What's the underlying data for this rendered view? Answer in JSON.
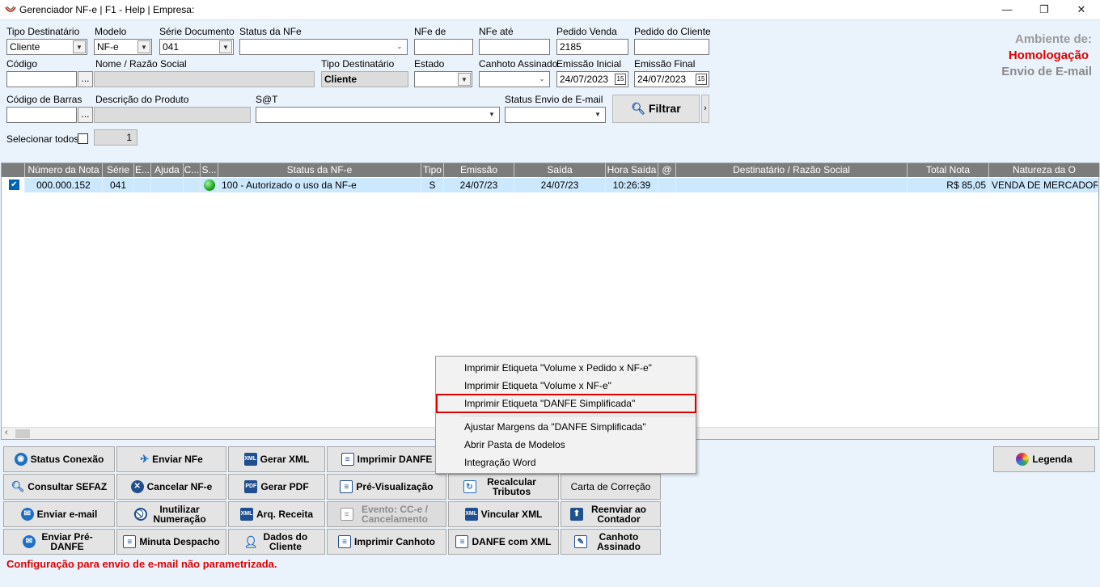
{
  "window": {
    "title": "Gerenciador NF-e | F1 - Help | Empresa:",
    "minimize": "—",
    "maximize": "❐",
    "close": "✕"
  },
  "filters": {
    "tipo_destinatario": {
      "label": "Tipo Destinatário",
      "value": "Cliente"
    },
    "modelo": {
      "label": "Modelo",
      "value": "NF-e"
    },
    "serie_documento": {
      "label": "Série Documento",
      "value": "041"
    },
    "status_nfe": {
      "label": "Status da NFe",
      "value": ""
    },
    "nfe_de": {
      "label": "NFe de",
      "value": ""
    },
    "nfe_ate": {
      "label": "NFe até",
      "value": ""
    },
    "pedido_venda": {
      "label": "Pedido Venda",
      "value": "2185"
    },
    "pedido_cliente": {
      "label": "Pedido do Cliente",
      "value": ""
    },
    "codigo": {
      "label": "Código",
      "value": "",
      "button": "..."
    },
    "nome_razao": {
      "label": "Nome / Razão Social",
      "value": ""
    },
    "tipo_destinatario2": {
      "label": "Tipo Destinatário",
      "value": "Cliente"
    },
    "estado": {
      "label": "Estado",
      "value": ""
    },
    "canhoto_assinado": {
      "label": "Canhoto Assinado",
      "value": ""
    },
    "emissao_inicial": {
      "label": "Emissão Inicial",
      "value": "24/07/2023"
    },
    "emissao_final": {
      "label": "Emissão Final",
      "value": "24/07/2023"
    },
    "codigo_barras": {
      "label": "Código de Barras",
      "value": "",
      "button": "..."
    },
    "descricao_produto": {
      "label": "Descrição do Produto",
      "value": ""
    },
    "sat": {
      "label": "S@T",
      "value": ""
    },
    "status_envio_email": {
      "label": "Status Envio de E-mail",
      "value": ""
    },
    "filtrar": "Filtrar",
    "filtrar_more": "›",
    "selecionar_todos": "Selecionar todos?",
    "count": "1"
  },
  "environment": {
    "line1": "Ambiente de:",
    "line2": "Homologação",
    "line3": "Envio de E-mail"
  },
  "grid": {
    "headers": [
      "",
      "Número da Nota",
      "Série",
      "E...",
      "Ajuda",
      "C...",
      "S...",
      "Status da NF-e",
      "Tipo",
      "Emissão",
      "Saída",
      "Hora Saída",
      "@",
      "Destinatário / Razão Social",
      "Total Nota",
      "Natureza da O"
    ],
    "rows": [
      {
        "checked": true,
        "numero": "000.000.152",
        "serie": "041",
        "e": "",
        "ajuda": "",
        "c": "",
        "status": "100 - Autorizado o uso da NF-e",
        "tipo": "S",
        "emissao": "24/07/23",
        "saida": "24/07/23",
        "hora": "10:26:39",
        "at": "",
        "destinatario": "",
        "total": "R$ 85,05",
        "natureza": "VENDA DE MERCADORIA"
      }
    ]
  },
  "context_menu": {
    "items": [
      "Imprimir Etiqueta \"Volume x Pedido x NF-e\"",
      "Imprimir Etiqueta \"Volume x NF-e\"",
      "Imprimir Etiqueta \"DANFE Simplificada\"",
      "Ajustar Margens da \"DANFE Simplificada\"",
      "Abrir Pasta de Modelos",
      "Integração Word"
    ],
    "selected_index": 2
  },
  "buttons": {
    "status_conexao": "Status Conexão",
    "enviar_nfe": "Enviar NFe",
    "gerar_xml": "Gerar XML",
    "imprimir_danfe": "Imprimir DANFE",
    "consultar_sefaz": "Consultar SEFAZ",
    "cancelar_nfe": "Cancelar NF-e",
    "gerar_pdf": "Gerar PDF",
    "pre_visualizacao": "Pré-Visualização",
    "recalcular_tributos": "Recalcular Tributos",
    "carta_correcao": "Carta de Correção",
    "enviar_email": "Enviar e-mail",
    "inutilizar_numeracao": "Inutilizar Numeração",
    "arq_receita": "Arq. Receita",
    "evento_cce": "Evento: CC-e / Cancelamento",
    "vincular_xml": "Vincular XML",
    "reenviar_contador": "Reenviar ao Contador",
    "enviar_pre_danfe": "Enviar Pré-DANFE",
    "minuta_despacho": "Minuta Despacho",
    "dados_cliente": "Dados do Cliente",
    "imprimir_canhoto": "Imprimir Canhoto",
    "danfe_com_xml": "DANFE com XML",
    "canhoto_assinado": "Canhoto Assinado",
    "legenda": "Legenda"
  },
  "status_message": "Configuração para envio de e-mail não parametrizada.",
  "colors": {
    "accent": "#0078d7",
    "error": "#e00000",
    "grid_header": "#7c7c7c",
    "row_selected": "#cce8ff"
  }
}
